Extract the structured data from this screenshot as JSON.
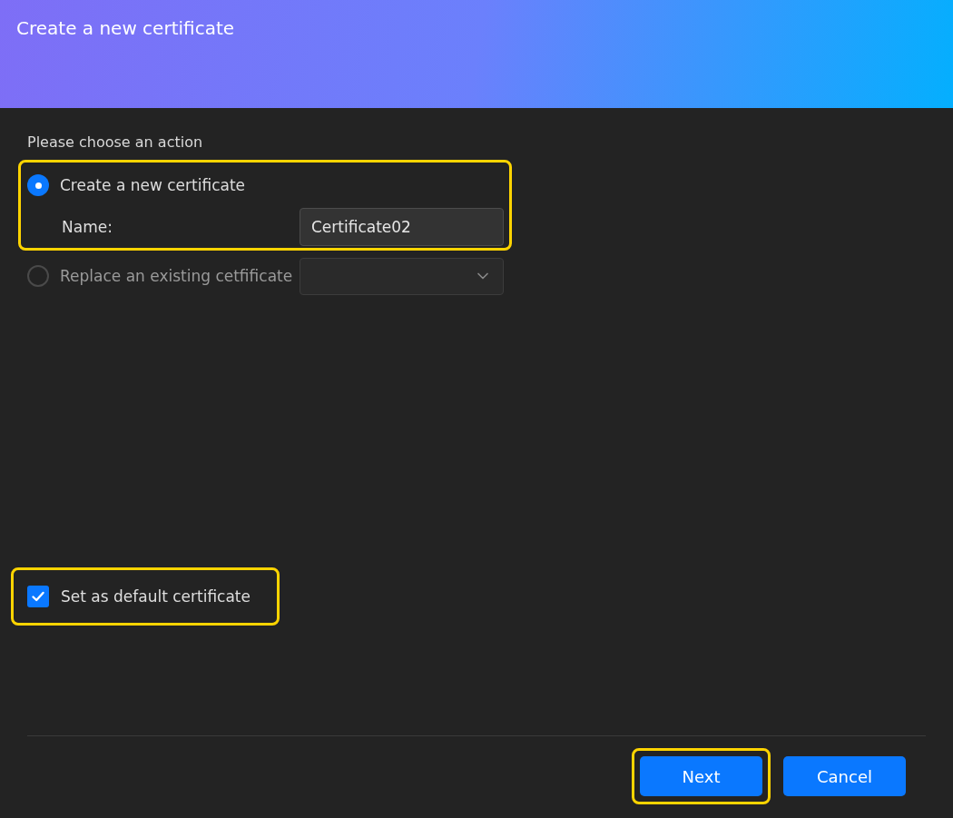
{
  "dialog": {
    "title": "Create a new certificate",
    "prompt": "Please choose an action",
    "options": [
      {
        "kind": "text",
        "label": "Create a new certificate",
        "selected": true,
        "disabled": false,
        "highlighted": true,
        "field": {
          "label": "Name:",
          "value": "Certificate02"
        }
      },
      {
        "kind": "dropdown",
        "label": "Replace an existing cetfificate",
        "selected": false,
        "disabled": true,
        "highlighted": false
      }
    ],
    "default_checkbox": {
      "label": "Set as default certificate",
      "checked": true,
      "highlighted": true
    },
    "buttons": [
      {
        "label": "Next",
        "highlighted": true
      },
      {
        "label": "Cancel",
        "highlighted": false
      }
    ]
  }
}
